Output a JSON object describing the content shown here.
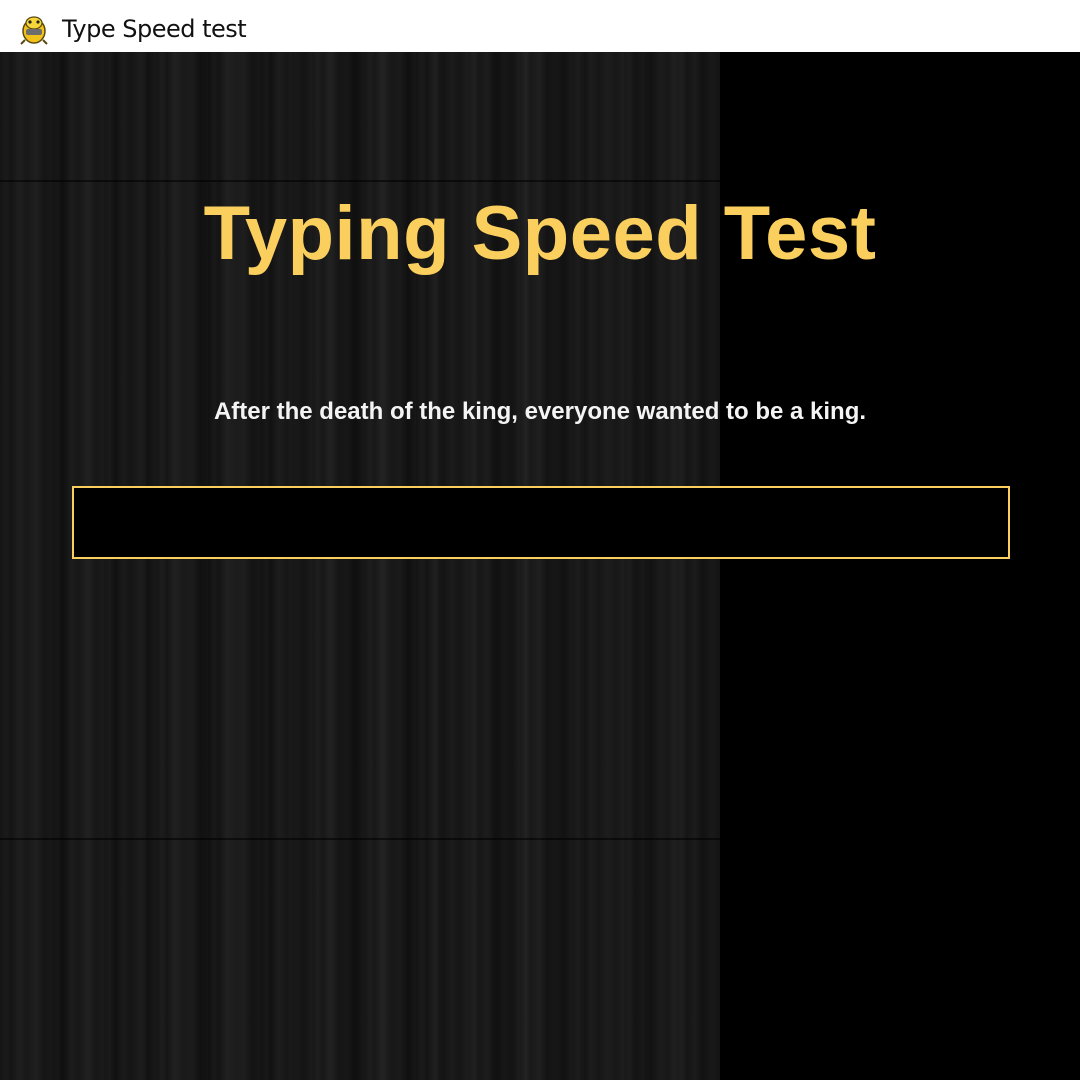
{
  "window": {
    "title": "Type Speed test",
    "icon": "pygame-snake-icon"
  },
  "main": {
    "heading": "Typing Speed Test",
    "sentence": "After the death of the king, everyone wanted to be a king.",
    "input_value": ""
  },
  "colors": {
    "accent": "#fbcf5d",
    "sentence_text": "#f4f4f4",
    "background": "#000000",
    "titlebar": "#ffffff"
  }
}
